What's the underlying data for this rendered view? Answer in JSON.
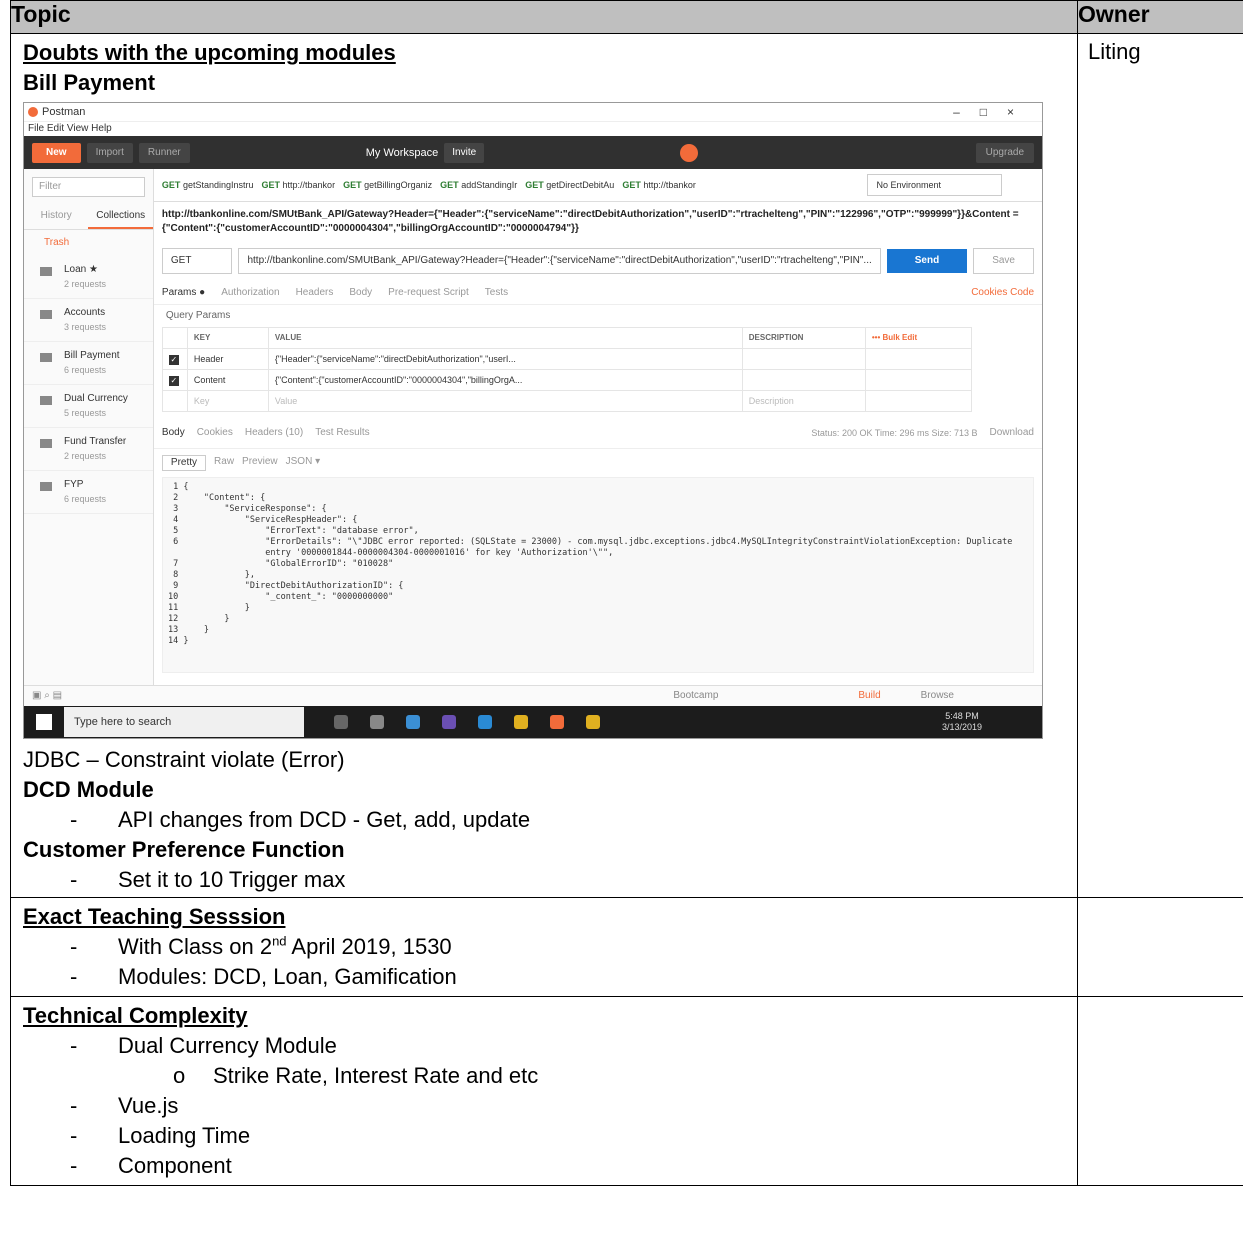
{
  "table": {
    "headers": {
      "topic": "Topic",
      "owner": "Owner"
    },
    "rows": [
      {
        "owner": "Liting",
        "heading": "Doubts with the upcoming modules",
        "bill_payment": "Bill Payment",
        "caption": "JDBC – Constraint violate (Error)",
        "dcd": "DCD Module",
        "dcd_bullet": "API changes from DCD - Get, add, update",
        "cpf": "Customer Preference Function",
        "cpf_bullet": "Set it to 10 Trigger max"
      },
      {
        "owner": "",
        "heading": "Exact Teaching Sesssion",
        "bullet1_pre": "With Class on 2",
        "bullet1_sup": "nd",
        "bullet1_post": " April 2019, 1530",
        "bullet2": "Modules: DCD, Loan, Gamification"
      },
      {
        "owner": "",
        "heading": "Technical Complexity",
        "b1": "Dual Currency Module",
        "b1_sub": "Strike Rate, Interest Rate and etc",
        "b2": "Vue.js",
        "b3": "Loading Time",
        "b4": "Component"
      }
    ]
  },
  "screenshot": {
    "app_title": "Postman",
    "menu": "File  Edit  View  Help",
    "toolbar": {
      "new": "New",
      "import": "Import",
      "runner": "Runner",
      "workspace": "My Workspace",
      "invite": "Invite",
      "upgrade": "Upgrade"
    },
    "filter": "Filter",
    "sidebar_tabs": [
      "History",
      "Collections"
    ],
    "trash": "Trash",
    "collections": [
      {
        "name": "Loan ★",
        "count": "2 requests"
      },
      {
        "name": "Accounts",
        "count": "3 requests"
      },
      {
        "name": "Bill Payment",
        "count": "6 requests"
      },
      {
        "name": "Dual Currency",
        "count": "5 requests"
      },
      {
        "name": "Fund Transfer",
        "count": "2 requests"
      },
      {
        "name": "FYP",
        "count": "6 requests"
      }
    ],
    "tabs": [
      "getStandingInstru",
      "http://tbankor",
      "getBillingOrganiz",
      "addStandingIr",
      "getDirectDebitAu",
      "http://tbankor"
    ],
    "environment": "No Environment",
    "url_full": "http://tbankonline.com/SMUtBank_API/Gateway?Header={\"Header\":{\"serviceName\":\"directDebitAuthorization\",\"userID\":\"rtrachelteng\",\"PIN\":\"122996\",\"OTP\":\"999999\"}}&Content ={\"Content\":{\"customerAccountID\":\"0000004304\",\"billingOrgAccountID\":\"0000004794\"}}",
    "method": "GET",
    "url_input": "http://tbankonline.com/SMUtBank_API/Gateway?Header={\"Header\":{\"serviceName\":\"directDebitAuthorization\",\"userID\":\"rtrachelteng\",\"PIN\"...",
    "send": "Send",
    "save": "Save",
    "param_tabs": [
      "Params ●",
      "Authorization",
      "Headers",
      "Body",
      "Pre-request Script",
      "Tests"
    ],
    "param_right": "Cookies  Code",
    "query_params": "Query Params",
    "kv_headers": [
      "KEY",
      "VALUE",
      "DESCRIPTION",
      "••• Bulk Edit"
    ],
    "kv_rows": [
      {
        "key": "Header",
        "value": "{\"Header\":{\"serviceName\":\"directDebitAuthorization\",\"userI...",
        "desc": ""
      },
      {
        "key": "Content",
        "value": "{\"Content\":{\"customerAccountID\":\"0000004304\",\"billingOrgA...",
        "desc": ""
      },
      {
        "key": "Key",
        "value": "Value",
        "desc": "Description"
      }
    ],
    "resp_tabs": [
      "Body",
      "Cookies",
      "Headers (10)",
      "Test Results"
    ],
    "status": "Status: 200 OK   Time: 296 ms   Size: 713 B",
    "download": "Download",
    "pretty_tabs": [
      "Pretty",
      "Raw",
      "Preview",
      "JSON ▾"
    ],
    "code": "  1 {\n  2     \"Content\": {\n  3         \"ServiceResponse\": {\n  4             \"ServiceRespHeader\": {\n  5                 \"ErrorText\": \"database error\",\n  6                 \"ErrorDetails\": \"\\\"JDBC error reported: (SQLState = 23000) - com.mysql.jdbc.exceptions.jdbc4.MySQLIntegrityConstraintViolationException: Duplicate\n                    entry '0000001844-0000004304-0000001016' for key 'Authorization'\\\"\",\n  7                 \"GlobalErrorID\": \"010028\"\n  8             },\n  9             \"DirectDebitAuthorizationID\": {\n 10                 \"_content_\": \"0000000000\"\n 11             }\n 12         }\n 13     }\n 14 }",
    "footer": {
      "bootcamp": "Bootcamp",
      "build": "Build",
      "browse": "Browse"
    },
    "taskbar": {
      "search": "Type here to search",
      "time": "5:48 PM",
      "date": "3/13/2019"
    }
  }
}
